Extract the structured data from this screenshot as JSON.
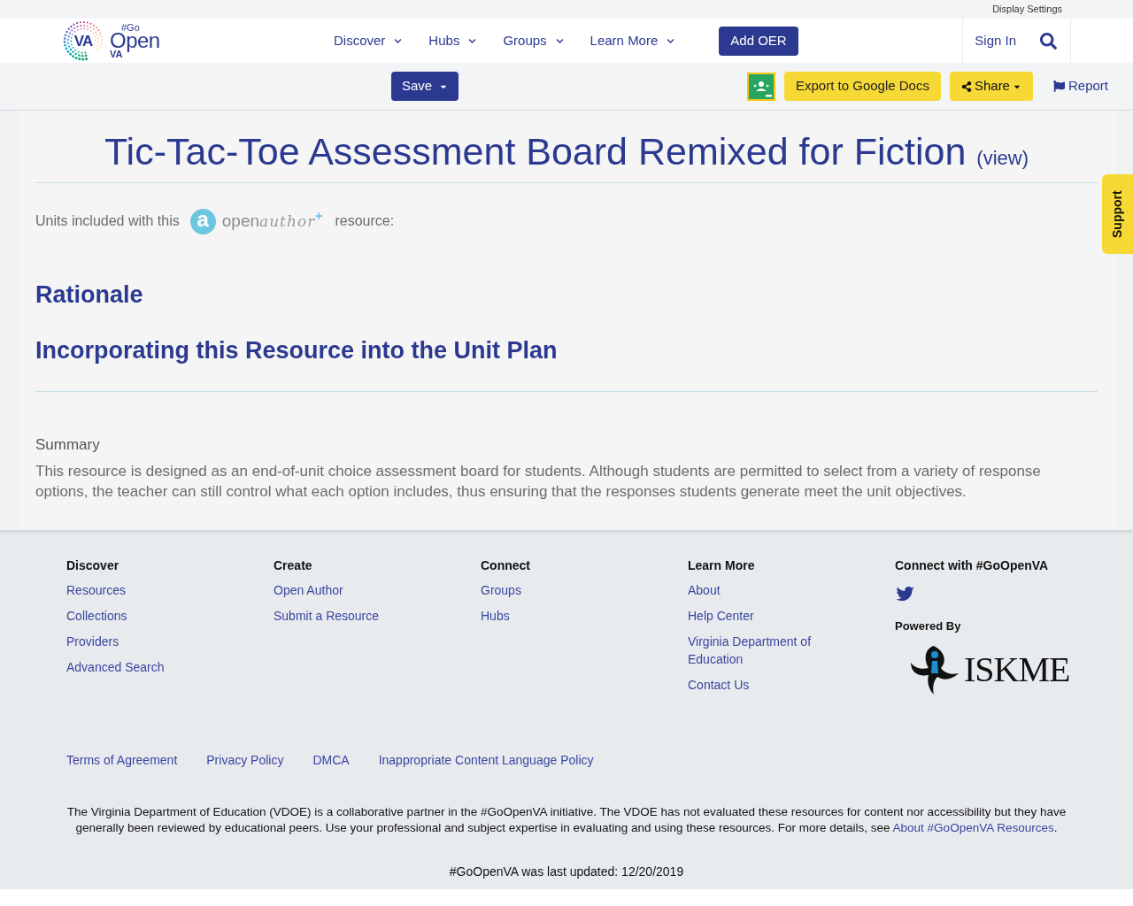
{
  "top_bar": {
    "display_settings": "Display Settings"
  },
  "header": {
    "logo": {
      "badge": "VA",
      "tag": "#Go",
      "word": "Open",
      "sub": "VA"
    },
    "nav": [
      {
        "label": "Discover"
      },
      {
        "label": "Hubs"
      },
      {
        "label": "Groups"
      },
      {
        "label": "Learn More"
      }
    ],
    "add_button": "Add OER",
    "sign_in": "Sign In"
  },
  "toolbar": {
    "save": "Save",
    "export": "Export to Google Docs",
    "share": "Share",
    "report": "Report"
  },
  "resource": {
    "title": "Tic-Tac-Toe Assessment Board Remixed for Fiction",
    "view_link": "(view)",
    "units_before": "Units included with this",
    "units_after": "resource:",
    "open_author_logo": {
      "mark": "a",
      "open": "open",
      "author": "author",
      "plus": "+"
    },
    "sections": [
      "Rationale",
      "Incorporating this Resource into the Unit Plan"
    ],
    "summary_label": "Summary",
    "summary": "This resource is designed as an end-of-unit choice assessment board for students. Although students are permitted to select from a variety of response options, the teacher can still control what each option includes, thus ensuring that the responses students generate meet the unit objectives."
  },
  "support_tab": "Support",
  "footer": {
    "columns": [
      {
        "heading": "Discover",
        "links": [
          "Resources",
          "Collections",
          "Providers",
          "Advanced Search"
        ]
      },
      {
        "heading": "Create",
        "links": [
          "Open Author",
          "Submit a Resource"
        ]
      },
      {
        "heading": "Connect",
        "links": [
          "Groups",
          "Hubs"
        ]
      },
      {
        "heading": "Learn More",
        "links": [
          "About",
          "Help Center",
          "Virginia Department of Education",
          "Contact Us"
        ]
      }
    ],
    "connect": {
      "heading": "Connect with #GoOpenVA",
      "powered_by": "Powered By",
      "iskme": "ISKME"
    },
    "legal_links": [
      "Terms of Agreement",
      "Privacy Policy",
      "DMCA",
      "Inappropriate Content Language Policy"
    ],
    "disclaimer": "The Virginia Department of Education (VDOE) is a collaborative partner in the #GoOpenVA initiative. The VDOE has not evaluated these resources for content nor accessibility but they have generally been reviewed by educational peers. Use your professional and subject expertise in evaluating and using these resources. For more details, see",
    "disclaimer_link": "About #GoOpenVA Resources",
    "disclaimer_end": ".",
    "updated": "#GoOpenVA was last updated: 12/20/2019"
  }
}
